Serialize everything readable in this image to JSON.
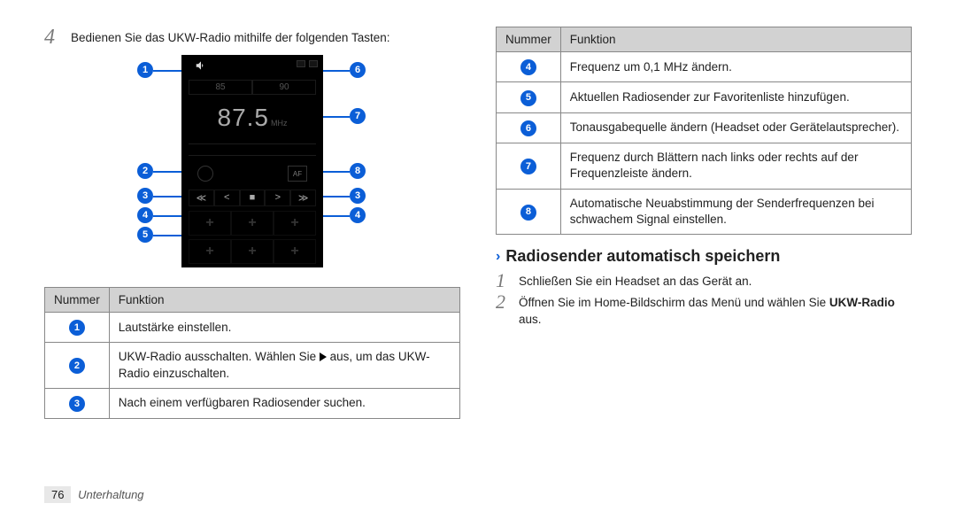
{
  "left": {
    "step4_num": "4",
    "step4_text": "Bedienen Sie das UKW-Radio mithilfe der folgenden Tasten:",
    "phone": {
      "preset_a": "85",
      "preset_b": "90",
      "freq": "87.5",
      "unit": "MHz",
      "af": "AF",
      "controls": [
        "≪",
        "<",
        "■",
        ">",
        "≫"
      ],
      "plus": "+"
    },
    "annot_labels": {
      "a1": "1",
      "a2": "2",
      "a3": "3",
      "a4": "4",
      "a5": "5",
      "a6": "6",
      "a7": "7",
      "a8": "8",
      "a3r": "3",
      "a4r": "4"
    },
    "table": {
      "head_num": "Nummer",
      "head_func": "Funktion",
      "rows": [
        {
          "n": "1",
          "t": "Lautstärke einstellen."
        },
        {
          "n": "2",
          "t_pre": "UKW-Radio ausschalten. Wählen Sie ",
          "t_post": " aus, um das UKW-Radio einzuschalten."
        },
        {
          "n": "3",
          "t": "Nach einem verfügbaren Radiosender suchen."
        }
      ]
    }
  },
  "right": {
    "table": {
      "head_num": "Nummer",
      "head_func": "Funktion",
      "rows": [
        {
          "n": "4",
          "t": "Frequenz um 0,1 MHz ändern."
        },
        {
          "n": "5",
          "t": "Aktuellen Radiosender zur Favoritenliste hinzufügen."
        },
        {
          "n": "6",
          "t": "Tonausgabequelle ändern (Headset oder Gerätelautsprecher)."
        },
        {
          "n": "7",
          "t": "Frequenz durch Blättern nach links oder rechts auf der Frequenzleiste ändern."
        },
        {
          "n": "8",
          "t": "Automatische Neuabstimmung der Senderfrequenzen bei schwachem Signal einstellen."
        }
      ]
    },
    "heading": "Radiosender automatisch speichern",
    "sub1_num": "1",
    "sub1_text": "Schließen Sie ein Headset an das Gerät an.",
    "sub2_num": "2",
    "sub2_text_pre": "Öffnen Sie im Home-Bildschirm das Menü und wählen Sie ",
    "sub2_bold": "UKW-Radio",
    "sub2_text_post": " aus."
  },
  "footer": {
    "page": "76",
    "section": "Unterhaltung"
  }
}
